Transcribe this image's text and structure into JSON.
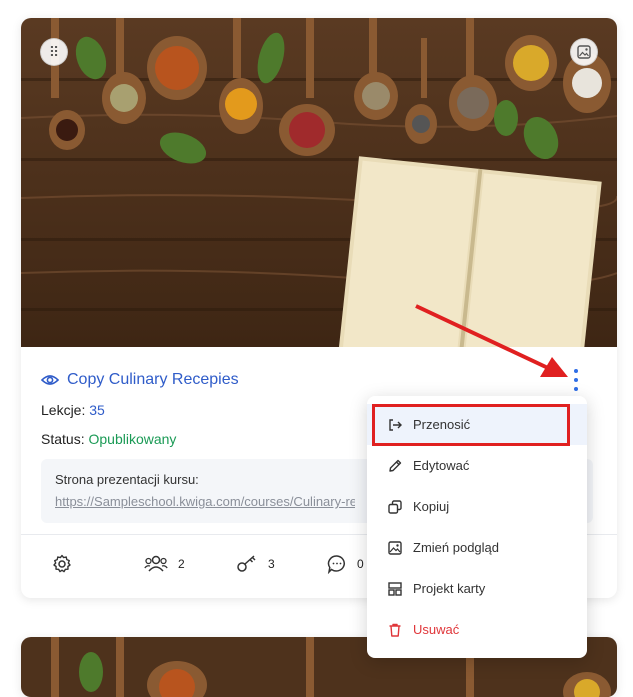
{
  "course": {
    "title": "Copy Culinary Recepies",
    "lessons_label": "Lekcje:",
    "lessons_count": "35",
    "status_label": "Status:",
    "status_value": "Opublikowany",
    "presentation_label": "Strona prezentacji kursu:",
    "presentation_url": "https://Sampleschool.kwiga.com/courses/Culinary-recepies"
  },
  "stats": {
    "students": "2",
    "keys": "3",
    "comments": "0"
  },
  "menu": {
    "items": [
      {
        "label": "Przenosić",
        "icon": "move-icon"
      },
      {
        "label": "Edytować",
        "icon": "pencil-icon"
      },
      {
        "label": "Kopiuj",
        "icon": "copy-icon"
      },
      {
        "label": "Zmień podgląd",
        "icon": "image-icon"
      },
      {
        "label": "Projekt karty",
        "icon": "layout-icon"
      },
      {
        "label": "Usuwać",
        "icon": "trash-icon"
      }
    ]
  },
  "colors": {
    "accent": "#2f5cc9",
    "published": "#1a9a55",
    "danger": "#e0363a",
    "highlight": "#e02020"
  }
}
